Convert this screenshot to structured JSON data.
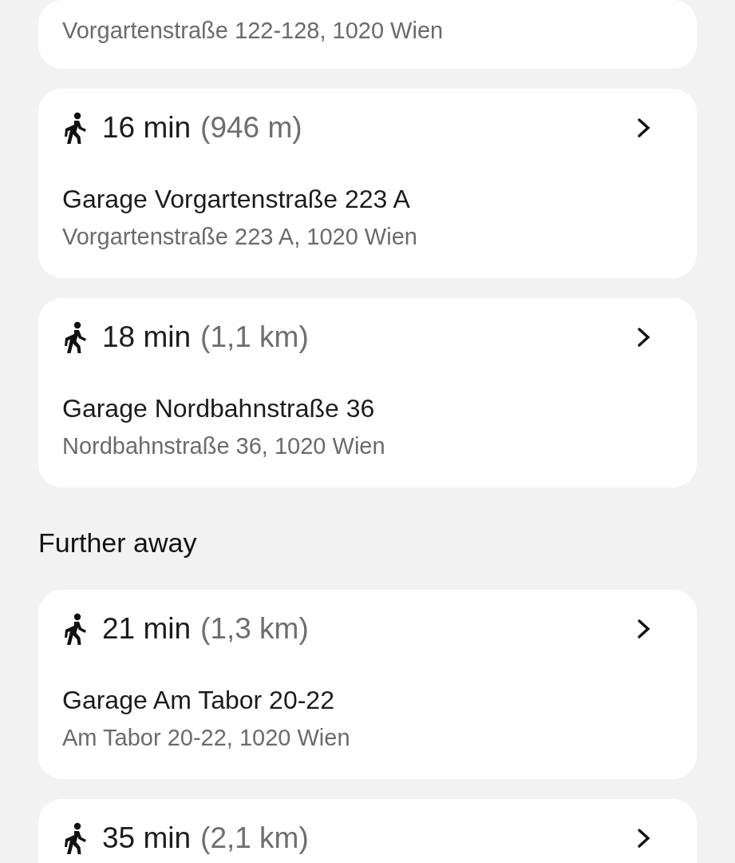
{
  "nearby": [
    {
      "address": "Vorgartenstraße 122-128, 1020 Wien"
    },
    {
      "walk_time": "16 min",
      "distance": "(946 m)",
      "name": "Garage Vorgartenstraße 223 A",
      "address": "Vorgartenstraße 223 A, 1020 Wien"
    },
    {
      "walk_time": "18 min",
      "distance": "(1,1 km)",
      "name": "Garage Nordbahnstraße 36",
      "address": "Nordbahnstraße 36, 1020 Wien"
    }
  ],
  "further_away": {
    "heading": "Further away",
    "garages": [
      {
        "walk_time": "21 min",
        "distance": "(1,3 km)",
        "name": "Garage Am Tabor 20-22",
        "address": "Am Tabor 20-22, 1020 Wien"
      },
      {
        "walk_time": "35 min",
        "distance": "(2,1 km)"
      }
    ]
  }
}
